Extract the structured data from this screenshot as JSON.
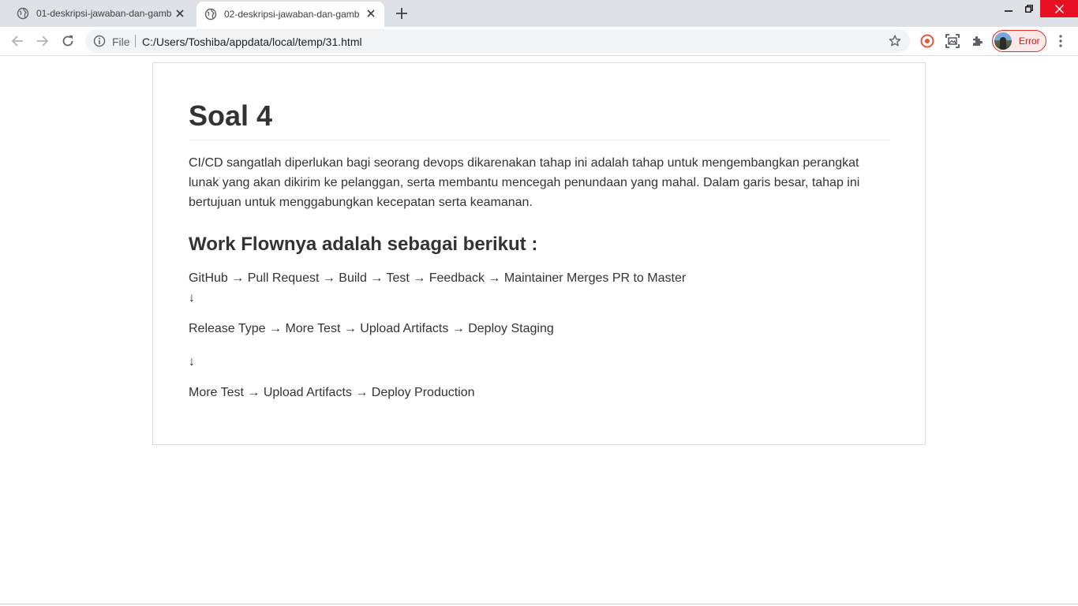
{
  "browser": {
    "tabs": [
      {
        "title": "01-deskripsi-jawaban-dan-gamb",
        "active": false,
        "icon": "globe-icon"
      },
      {
        "title": "02-deskripsi-jawaban-dan-gamb",
        "active": true,
        "icon": "globe-icon"
      }
    ],
    "address": {
      "scheme_label": "File",
      "url": "C:/Users/Toshiba/appdata/local/temp/31.html"
    },
    "profile": {
      "label": "Error"
    },
    "icons": {
      "back": "arrow-left-icon",
      "forward": "arrow-right-icon",
      "reload": "reload-icon",
      "info": "info-icon",
      "bookmark": "star-icon",
      "extension_1": "record-icon",
      "extension_2": "screenshot-icon",
      "extensions": "puzzle-icon",
      "menu": "kebab-menu-icon"
    },
    "colors": {
      "tabstrip": "#dee1e6",
      "close_button": "#e81123",
      "profile_error": "#d93025"
    }
  },
  "page": {
    "heading": "Soal 4",
    "intro": "CI/CD sangatlah diperlukan bagi seorang devops dikarenakan tahap ini adalah tahap untuk mengembangkan perangkat lunak yang akan dikirim ke pelanggan, serta membantu mencegah penundaan yang mahal. Dalam garis besar, tahap ini bertujuan untuk menggabungkan kecepatan serta keamanan.",
    "subheading": "Work Flownya adalah sebagai berikut :",
    "flow": {
      "line1": "GitHub → Pull Request → Build → Test → Feedback → Maintainer Merges PR to Master",
      "arrow1": "↓",
      "line2": "Release Type → More Test → Upload Artifacts → Deploy Staging",
      "arrow2": "↓",
      "line3": "More Test → Upload Artifacts → Deploy Production"
    }
  }
}
